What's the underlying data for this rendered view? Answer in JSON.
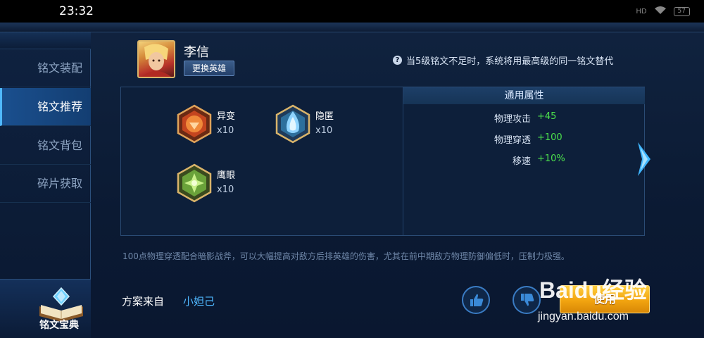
{
  "status_bar": {
    "time": "23:32",
    "signal": "HD",
    "battery": "57"
  },
  "sidebar": {
    "items": [
      {
        "label": "铭文装配",
        "active": false
      },
      {
        "label": "铭文推荐",
        "active": true
      },
      {
        "label": "铭文背包",
        "active": false
      },
      {
        "label": "碎片获取",
        "active": false
      }
    ],
    "book_label": "铭文宝典"
  },
  "hero": {
    "name": "李信",
    "change_label": "更换英雄"
  },
  "notice": "当5级铭文不足时，系统将用最高级的同一铭文替代",
  "runes": [
    {
      "name": "异变",
      "count": "x10",
      "color": "#d9572a",
      "icon": "rune-yibian-icon"
    },
    {
      "name": "隐匿",
      "count": "x10",
      "color": "#4aa7d8",
      "icon": "rune-yinni-icon"
    },
    {
      "name": "鹰眼",
      "count": "x10",
      "color": "#7dc24a",
      "icon": "rune-yingyan-icon"
    }
  ],
  "attributes": {
    "header": "通用属性",
    "rows": [
      {
        "name": "物理攻击",
        "value": "+45"
      },
      {
        "name": "物理穿透",
        "value": "+100"
      },
      {
        "name": "移速",
        "value": "+10%"
      }
    ]
  },
  "description": "100点物理穿透配合暗影战斧，可以大幅提高对敌方后排英雄的伤害，尤其在前中期敌方物理防御偏低时，压制力极强。",
  "source": {
    "label": "方案来自",
    "author": "小妲己"
  },
  "actions": {
    "like_icon": "thumbs-up-icon",
    "dislike_icon": "thumbs-down-icon",
    "use_label": "使用"
  },
  "watermark": {
    "logo": "Baidu经验",
    "site": "jingyan.baidu.com"
  },
  "colors": {
    "accent": "#4fb8ff",
    "positive": "#4ce04c",
    "use_button": "#f2a410"
  }
}
